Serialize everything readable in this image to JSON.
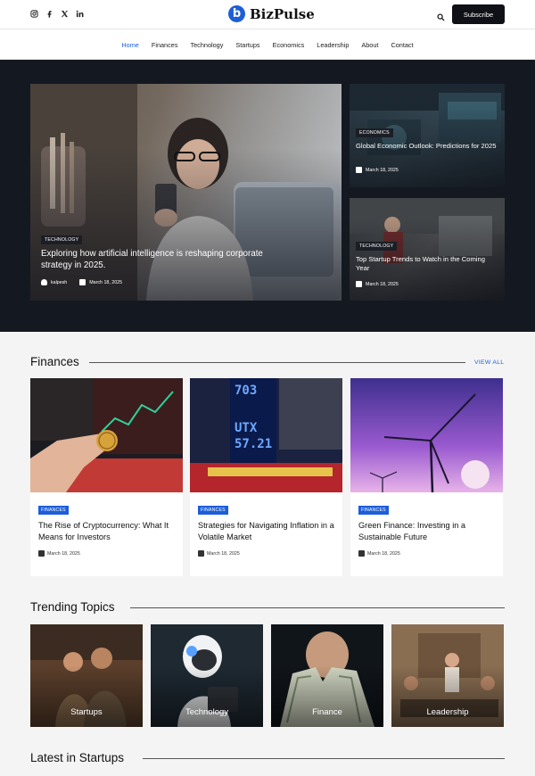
{
  "header": {
    "brand": "BizPulse",
    "brand_initial": "b",
    "social_icons": [
      "instagram-icon",
      "facebook-icon",
      "x-icon",
      "linkedin-icon"
    ],
    "subscribe_label": "Subscribe"
  },
  "nav": {
    "items": [
      "Home",
      "Finances",
      "Technology",
      "Startups",
      "Economics",
      "Leadership",
      "About",
      "Contact"
    ],
    "active": "Home"
  },
  "hero": {
    "main": {
      "tag": "TECHNOLOGY",
      "title": "Exploring how artificial intelligence is reshaping corporate strategy in 2025.",
      "author": "kalpesh",
      "date": "March 18, 2025"
    },
    "side": [
      {
        "tag": "ECONOMICS",
        "title": "Global Economic Outlook: Predictions for 2025",
        "date": "March 18, 2025"
      },
      {
        "tag": "TECHNOLOGY",
        "title": "Top Startup Trends to Watch in the Coming Year",
        "date": "March 18, 2025"
      }
    ]
  },
  "finances": {
    "title": "Finances",
    "view_all": "VIEW ALL",
    "cards": [
      {
        "tag": "FINANCES",
        "title": "The Rise of Cryptocurrency: What It Means for Investors",
        "date": "March 18, 2025"
      },
      {
        "tag": "FINANCES",
        "title": "Strategies for Navigating Inflation in a Volatile Market",
        "date": "March 18, 2025"
      },
      {
        "tag": "FINANCES",
        "title": "Green Finance: Investing in a Sustainable Future",
        "date": "March 18, 2025"
      }
    ]
  },
  "trending": {
    "title": "Trending Topics",
    "items": [
      "Startups",
      "Technology",
      "Finance",
      "Leadership"
    ]
  },
  "latest": {
    "title": "Latest in Startups"
  },
  "colors": {
    "accent": "#1d5ed8",
    "dark": "#141821",
    "button": "#0f1117"
  }
}
